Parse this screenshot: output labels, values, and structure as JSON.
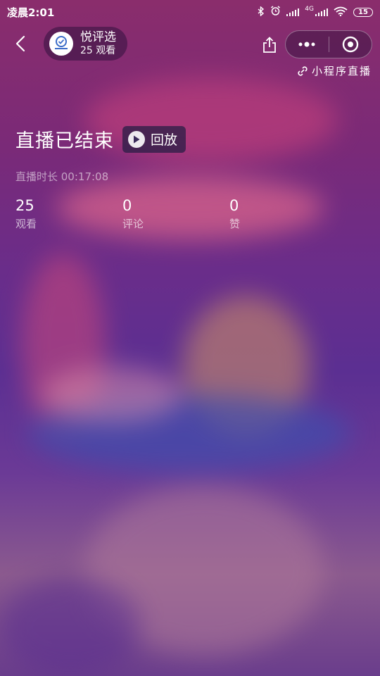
{
  "status_bar": {
    "time": "凌晨2:01",
    "network": "4G",
    "battery": "15"
  },
  "header": {
    "anchor_name": "悦评选",
    "anchor_views": "25 观看",
    "mini_program_tag": "小程序直播"
  },
  "live_end": {
    "title": "直播已结束",
    "replay_label": "回放",
    "duration": "直播时长 00:17:08"
  },
  "stats": [
    {
      "value": "25",
      "label": "观看"
    },
    {
      "value": "0",
      "label": "评论"
    },
    {
      "value": "0",
      "label": "赞"
    }
  ],
  "colors": {
    "background_top": "#8a2d6c",
    "background_mid": "#5b2f92",
    "background_bottom": "#6a3d8c"
  },
  "icons": [
    "bluetooth-icon",
    "alarm-icon",
    "signal-icon",
    "wifi-icon",
    "battery-icon",
    "back-icon",
    "share-icon",
    "more-icon",
    "close-mini-program-icon",
    "link-icon",
    "play-icon"
  ]
}
